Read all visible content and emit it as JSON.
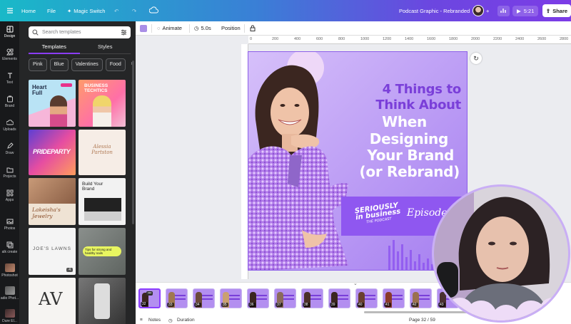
{
  "topbar": {
    "home": "Home",
    "file": "File",
    "magic_switch": "Magic Switch",
    "doc_title": "Podcast Graphic - Rebranded",
    "play_time": "5:21",
    "share": "Share"
  },
  "rail": {
    "items": [
      "Design",
      "Elements",
      "Text",
      "Brand",
      "Uploads",
      "Draw",
      "Projects",
      "Apps",
      "Photos",
      "alk create",
      "Photoshot",
      "adio Phot...",
      "Dure El..."
    ]
  },
  "panel": {
    "search_placeholder": "Search templates",
    "tabs": [
      "Templates",
      "Styles"
    ],
    "chips": [
      "Pink",
      "Blue",
      "Valentines",
      "Food"
    ],
    "templates": {
      "heart_full": "Heart Full",
      "business": "BUSINESS TECHTICS",
      "pride": "PRIDEPARTY",
      "script": "Alessia Partston",
      "jewelry": "Lakeisha's Jewelry",
      "build_brand": "Build Your Brand",
      "joes_lawns": "JOE'S LAWNS",
      "tips": "Tips for strong and healthy nails",
      "badge": "4"
    }
  },
  "context_bar": {
    "animate": "Animate",
    "duration": "5.0s",
    "position": "Position"
  },
  "ruler": [
    "0",
    "200",
    "400",
    "600",
    "800",
    "1000",
    "1200",
    "1400",
    "1600",
    "1800",
    "2000",
    "2200",
    "2400",
    "2600",
    "2800"
  ],
  "canvas": {
    "title_lines": [
      "4 Things to",
      "Think About",
      "When",
      "Designing",
      "Your Brand",
      "(or Rebrand)"
    ],
    "seriously": "SERIOUSLY",
    "in_business": "in business",
    "the_podcast": "THE PODCAST",
    "episode": "Episode 13"
  },
  "pages": {
    "numbers": [
      "32",
      "33",
      "34",
      "35",
      "36",
      "37",
      "38",
      "39",
      "40",
      "41",
      "42",
      "43"
    ],
    "selected_more": "•••"
  },
  "bottombar": {
    "notes": "Notes",
    "duration": "Duration",
    "page_info": "Page 32 / 59"
  },
  "colors": {
    "accent": "#8b3dff",
    "canvas_bg": "#b38ff0",
    "title_purple": "#7a3fd9"
  }
}
